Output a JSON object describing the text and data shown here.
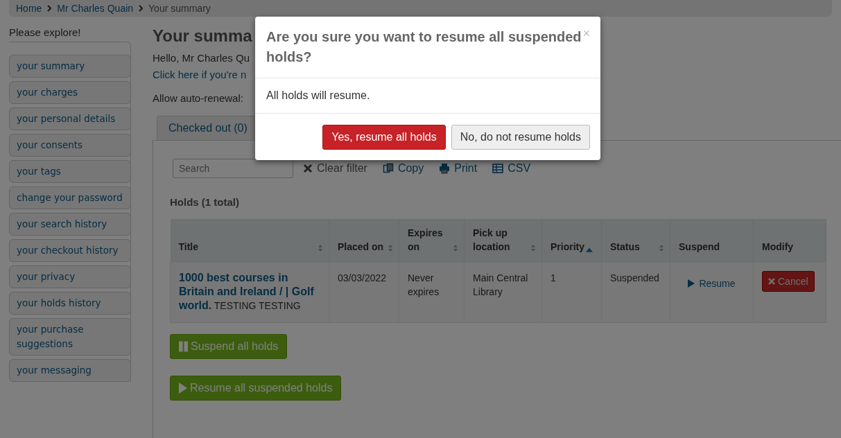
{
  "breadcrumb": [
    {
      "label": "Home",
      "link": true
    },
    {
      "label": "Mr Charles Quain",
      "link": true
    },
    {
      "label": "Your summary",
      "link": false
    }
  ],
  "sidebar": {
    "heading": "Please explore!",
    "items": [
      {
        "label": "your summary",
        "selected": false
      },
      {
        "label": "your charges",
        "selected": false
      },
      {
        "label": "your personal details",
        "selected": false
      },
      {
        "label": "your consents",
        "selected": false
      },
      {
        "label": "your tags",
        "selected": false
      },
      {
        "label": "change your password",
        "selected": false
      },
      {
        "label": "your search history",
        "selected": false
      },
      {
        "label": "your checkout history",
        "selected": false
      },
      {
        "label": "your privacy",
        "selected": false
      },
      {
        "label": "your holds history",
        "selected": false
      },
      {
        "label": "your purchase suggestions",
        "selected": false
      },
      {
        "label": "your messaging",
        "selected": false
      }
    ]
  },
  "main": {
    "heading": "Your summa",
    "greeting": "Hello, Mr Charles Qu",
    "not_you_link": "Click here if you're n",
    "auto_renewal_label": "Allow auto-renewal:",
    "tabs": [
      {
        "label": "Checked out (0)",
        "selected": false
      }
    ],
    "search": {
      "placeholder": "Search"
    },
    "toolbar": [
      {
        "kind": "clear",
        "label": "Clear filter"
      },
      {
        "kind": "copy",
        "label": "Copy"
      },
      {
        "kind": "print",
        "label": "Print"
      },
      {
        "kind": "csv",
        "label": "CSV"
      }
    ],
    "holds_heading": "Holds (1 total)",
    "table": {
      "columns": [
        {
          "label": "Title",
          "sortable": true,
          "sorted_ascending": false
        },
        {
          "label": "Placed on",
          "sortable": true,
          "sorted_ascending": false
        },
        {
          "label": "Expires on",
          "sortable": true,
          "sorted_ascending": false
        },
        {
          "label": "Pick up location",
          "sortable": true,
          "sorted_ascending": false
        },
        {
          "label": "Priority",
          "sortable": true,
          "sorted_ascending": true
        },
        {
          "label": "Status",
          "sortable": true,
          "sorted_ascending": false
        },
        {
          "label": "Suspend",
          "sortable": false
        },
        {
          "label": "Modify",
          "sortable": false
        }
      ],
      "rows": [
        {
          "title": "**1000 best courses in Britain and Ireland / | Golf world.** TESTING TESTING",
          "placed_on": "03/03/2022",
          "expires_on": "Never expires",
          "pickup": "Main Central Library",
          "priority": "1",
          "status": "Suspended",
          "suspend_action": "Resume",
          "modify_action": "Cancel"
        }
      ]
    },
    "buttons": [
      {
        "kind": "suspend",
        "label": "Suspend all holds"
      },
      {
        "kind": "resume",
        "label": "Resume all suspended holds"
      }
    ]
  },
  "dialog": {
    "title": "Are you sure you want to resume all suspended holds?",
    "close": "×",
    "message": "All holds will resume.",
    "confirm": "Yes, resume all holds",
    "cancel": "No, do not resume holds"
  }
}
